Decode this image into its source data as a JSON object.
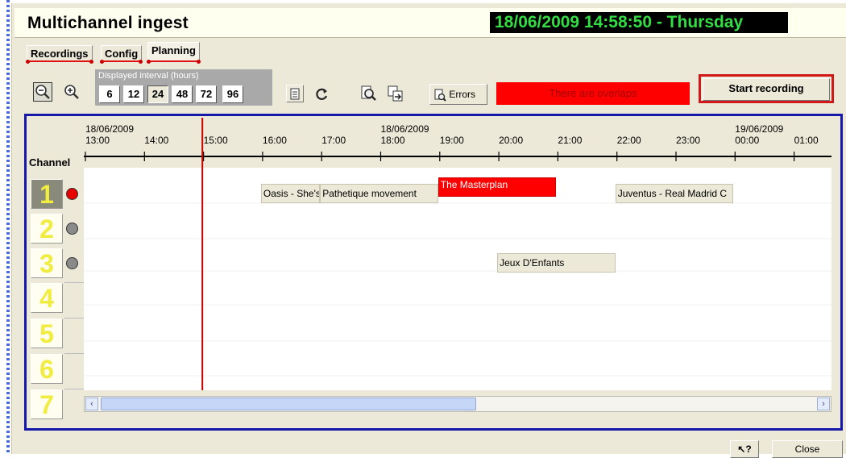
{
  "app": {
    "title": "Multichannel ingest",
    "clock": "18/06/2009 14:58:50 - Thursday"
  },
  "tabs": [
    {
      "label": "Recordings"
    },
    {
      "label": "Config"
    },
    {
      "label": "Planning"
    }
  ],
  "toolbar": {
    "interval_label": "Displayed interval (hours)",
    "intervals": [
      "6",
      "12",
      "24",
      "48",
      "72",
      "96"
    ],
    "selected_interval": "24",
    "errors_label": "Errors",
    "overlap_text": "There are overlaps",
    "start_recording_label": "Start recording"
  },
  "timeline": {
    "date_labels": [
      "18/06/2009",
      "18/06/2009",
      "19/06/2009"
    ],
    "hours": [
      "13:00",
      "14:00",
      "15:00",
      "16:00",
      "17:00",
      "18:00",
      "19:00",
      "20:00",
      "21:00",
      "22:00",
      "23:00",
      "00:00",
      "01:00"
    ]
  },
  "channels": {
    "header": "Channel",
    "items": [
      {
        "number": "1",
        "status_color": "#e60000"
      },
      {
        "number": "2",
        "status_color": "#8a8a8a"
      },
      {
        "number": "3",
        "status_color": "#8a8a8a"
      },
      {
        "number": "4"
      },
      {
        "number": "5"
      },
      {
        "number": "6"
      },
      {
        "number": "7"
      }
    ]
  },
  "events": [
    {
      "channel": "1",
      "title": "Oasis - She's",
      "start": "16:00",
      "end": "17:00",
      "overlap": false
    },
    {
      "channel": "1",
      "title": "Pathetique movement",
      "start": "17:00",
      "end": "19:00",
      "overlap": false
    },
    {
      "channel": "1",
      "title": "The Masterplan",
      "start": "19:00",
      "end": "21:00",
      "overlap": true
    },
    {
      "channel": "1",
      "title": "Juventus - Real Madrid C",
      "start": "22:00",
      "end": "00:00",
      "overlap": false
    },
    {
      "channel": "3",
      "title": "Jeux D'Enfants",
      "start": "20:00",
      "end": "22:00",
      "overlap": false
    }
  ],
  "current_time": "14:58:50",
  "footer": {
    "close_label": "Close",
    "help_icon_label": "?"
  },
  "colors": {
    "panel_border": "#1518a8",
    "overlap_red": "#ff0000",
    "clock_green": "#33dd44",
    "channel_digit": "#f0ec40",
    "now_line": "#cc0000"
  }
}
